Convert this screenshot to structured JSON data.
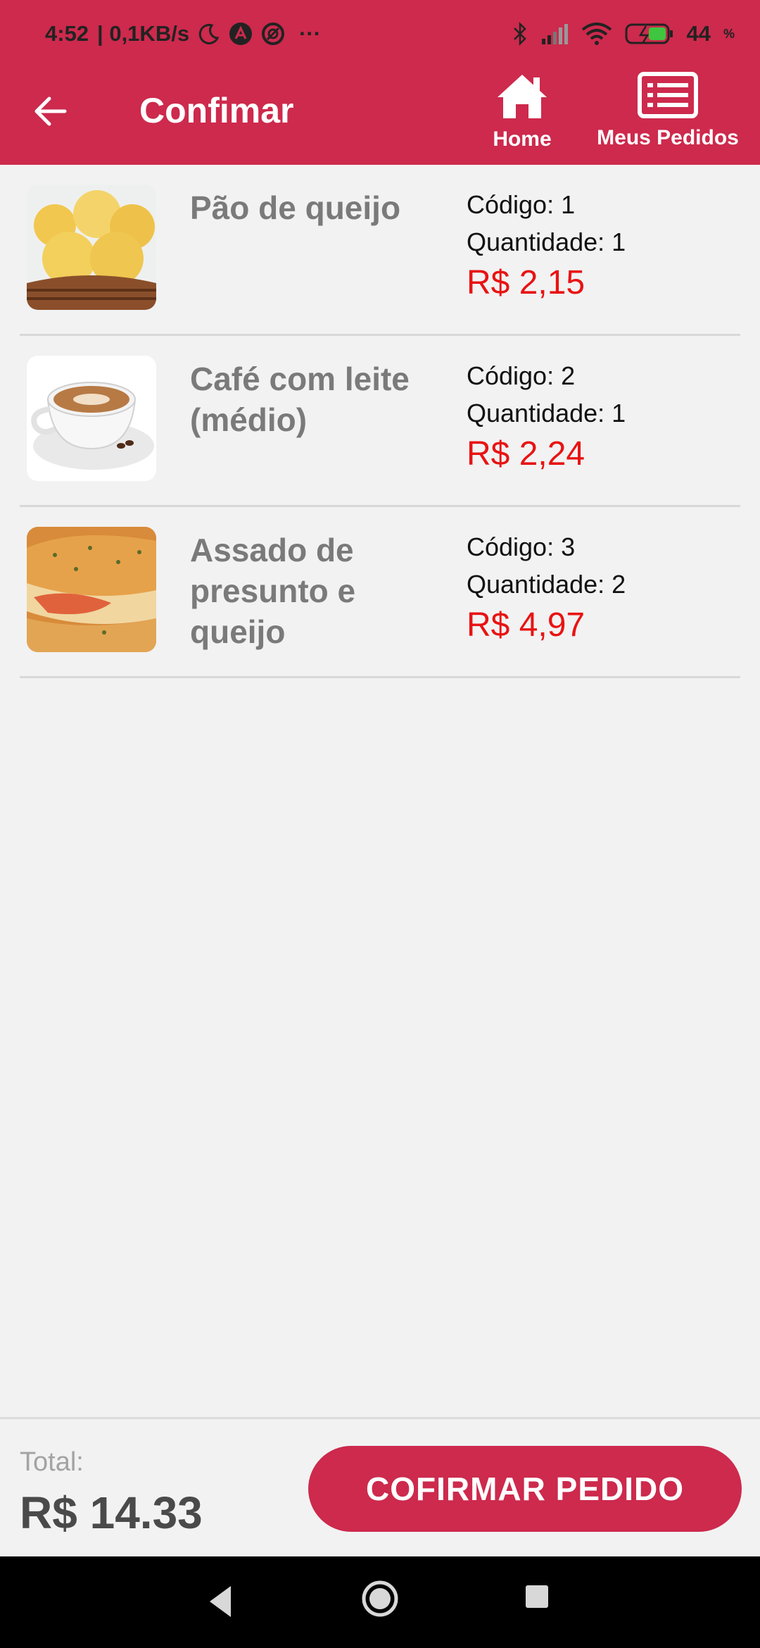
{
  "status_bar": {
    "time": "4:52",
    "net_speed": "| 0,1KB/s",
    "more": "···",
    "battery": "44"
  },
  "app_bar": {
    "title": "Confimar",
    "home_label": "Home",
    "orders_label": "Meus Pedidos"
  },
  "items": [
    {
      "name": "Pão de queijo",
      "code": "Código: 1",
      "quantity": "Quantidade: 1",
      "price": "R$ 2,15"
    },
    {
      "name": "Café com leite (médio)",
      "code": "Código: 2",
      "quantity": "Quantidade: 1",
      "price": "R$ 2,24"
    },
    {
      "name": "Assado de presunto e queijo",
      "code": "Código: 3",
      "quantity": "Quantidade: 2",
      "price": "R$ 4,97"
    }
  ],
  "footer": {
    "total_label": "Total:",
    "total_value": "R$ 14.33",
    "confirm_label": "COFIRMAR PEDIDO"
  },
  "colors": {
    "primary": "#cd2a4d",
    "price": "#e81313",
    "background": "#f2f2f2"
  }
}
